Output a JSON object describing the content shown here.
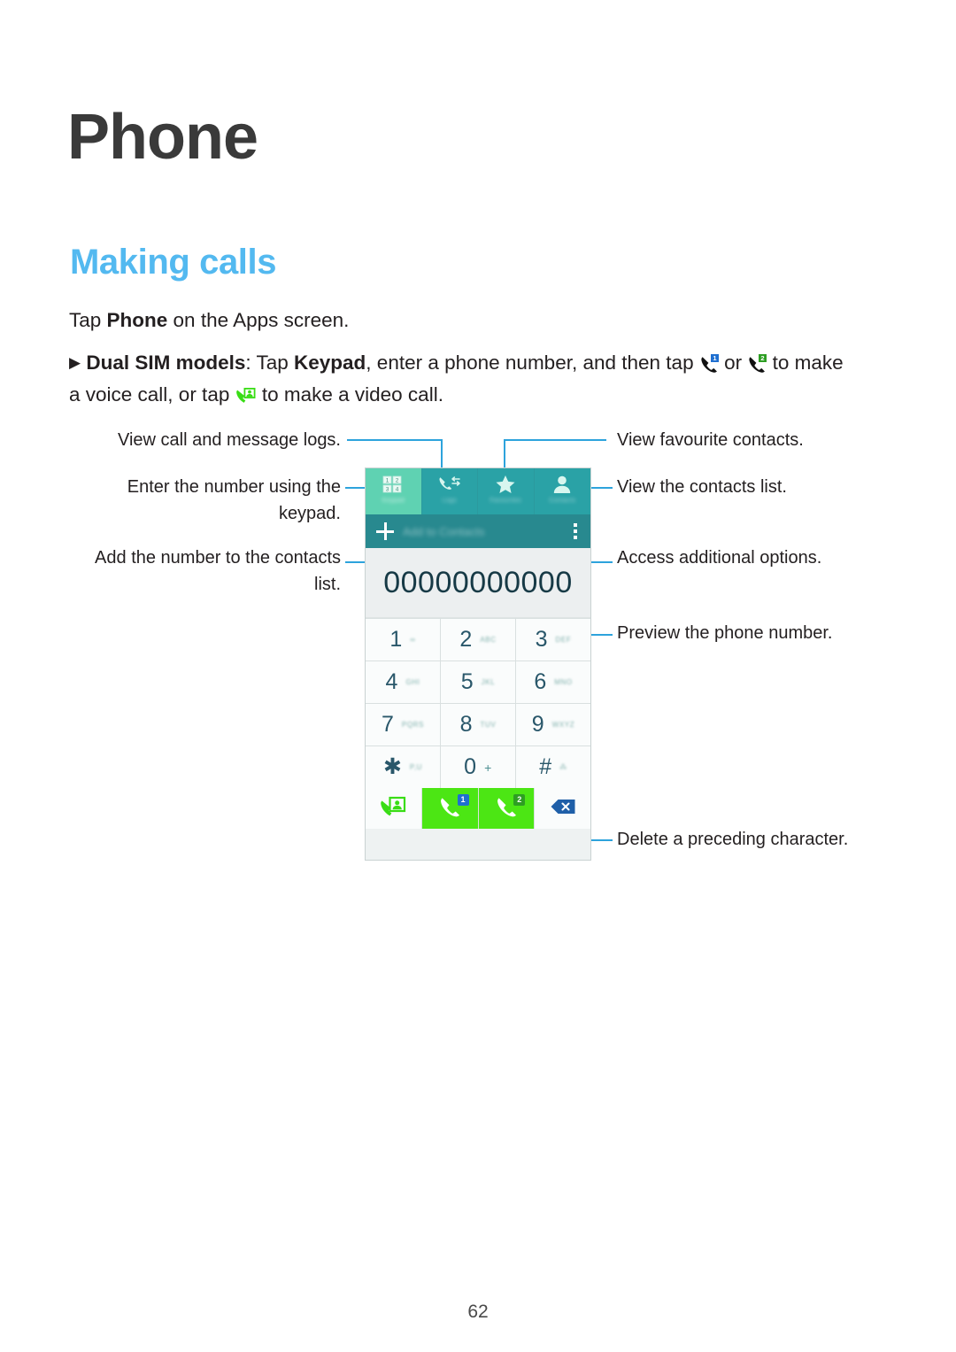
{
  "page": {
    "title": "Phone",
    "section_title": "Making calls",
    "number": "62"
  },
  "body": {
    "line1_pre": "Tap ",
    "line1_bold": "Phone",
    "line1_post": " on the Apps screen.",
    "bullet_marker": "▶",
    "para2_bold1": "Dual SIM models",
    "para2_t1": ": Tap ",
    "para2_bold2": "Keypad",
    "para2_t2": ", enter a phone number, and then tap ",
    "para2_t3": " or ",
    "para2_t4": " to make a voice call, or tap ",
    "para2_t5": " to make a video call.",
    "icon_call_sim1": "call-sim1-icon",
    "icon_call_sim2": "call-sim2-icon",
    "icon_video_call": "video-call-icon"
  },
  "device": {
    "tabs": [
      {
        "label": "Keypad",
        "icon": "keypad-icon",
        "active": true
      },
      {
        "label": "Logs",
        "icon": "logs-icon",
        "active": false
      },
      {
        "label": "Favourites",
        "icon": "star-icon",
        "active": false
      },
      {
        "label": "Contacts",
        "icon": "contact-icon",
        "active": false
      }
    ],
    "add_bar": {
      "plus_icon": "plus-icon",
      "label": "Add to Contacts",
      "more_icon": "more-options-icon"
    },
    "phone_number": "00000000000",
    "keypad": [
      {
        "digit": "1",
        "letters": "∞",
        "blur": true
      },
      {
        "digit": "2",
        "letters": "ABC",
        "blur": true
      },
      {
        "digit": "3",
        "letters": "DEF",
        "blur": true
      },
      {
        "digit": "4",
        "letters": "GHI",
        "blur": true
      },
      {
        "digit": "5",
        "letters": "JKL",
        "blur": true
      },
      {
        "digit": "6",
        "letters": "MNO",
        "blur": true
      },
      {
        "digit": "7",
        "letters": "PQRS",
        "blur": true
      },
      {
        "digit": "8",
        "letters": "TUV",
        "blur": true
      },
      {
        "digit": "9",
        "letters": "WXYZ",
        "blur": true
      },
      {
        "digit": "✱",
        "letters": "P,U",
        "blur": true
      },
      {
        "digit": "0",
        "letters": "+",
        "blur": false
      },
      {
        "digit": "#",
        "letters": "⁂",
        "blur": true
      }
    ],
    "actions": [
      {
        "name": "video-call-button",
        "badge": null
      },
      {
        "name": "call-sim1-button",
        "badge": "1"
      },
      {
        "name": "call-sim2-button",
        "badge": "2"
      },
      {
        "name": "backspace-button",
        "badge": null
      }
    ]
  },
  "callouts": {
    "logs": "View call and message logs.",
    "keypad": "Enter the number using the\nkeypad.",
    "add_contacts": "Add the number to the contacts\nlist.",
    "favourites": "View favourite contacts.",
    "contacts": "View the contacts list.",
    "more_options": "Access additional options.",
    "preview": "Preview the phone number.",
    "backspace": "Delete a preceding character."
  },
  "colors": {
    "accent_heading": "#53b9f0",
    "leader_line": "#2da3dc",
    "tab_active": "#5fd2b2",
    "tab_inactive": "#2aa2a6",
    "add_bar": "#28898f",
    "call_green": "#4ce614",
    "badge_sim1": "#1f6fd0",
    "badge_sim2": "#2e9e23"
  }
}
